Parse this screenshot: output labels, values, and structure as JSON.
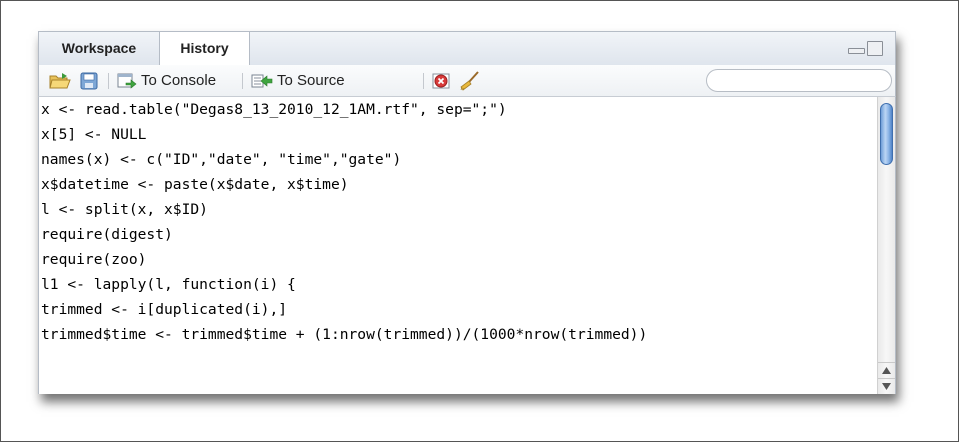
{
  "tabs": [
    {
      "label": "Workspace"
    },
    {
      "label": "History"
    }
  ],
  "toolbar": {
    "to_console_label": "To Console",
    "to_source_label": "To Source",
    "search_placeholder": ""
  },
  "history": {
    "lines": [
      "x <- read.table(\"Degas8_13_2010_12_1AM.rtf\", sep=\";\")",
      "x[5] <- NULL",
      "names(x) <- c(\"ID\",\"date\", \"time\",\"gate\")",
      "x$datetime <- paste(x$date, x$time)",
      "l <- split(x, x$ID)",
      "require(digest)",
      "require(zoo)",
      "l1 <- lapply(l, function(i) {",
      "trimmed <- i[duplicated(i),]",
      "trimmed$time <- trimmed$time + (1:nrow(trimmed))/(1000*nrow(trimmed))"
    ]
  },
  "colors": {
    "accent": "#4f83c7",
    "tab_bg": "#dfe5ed",
    "border": "#b5bcc6"
  }
}
